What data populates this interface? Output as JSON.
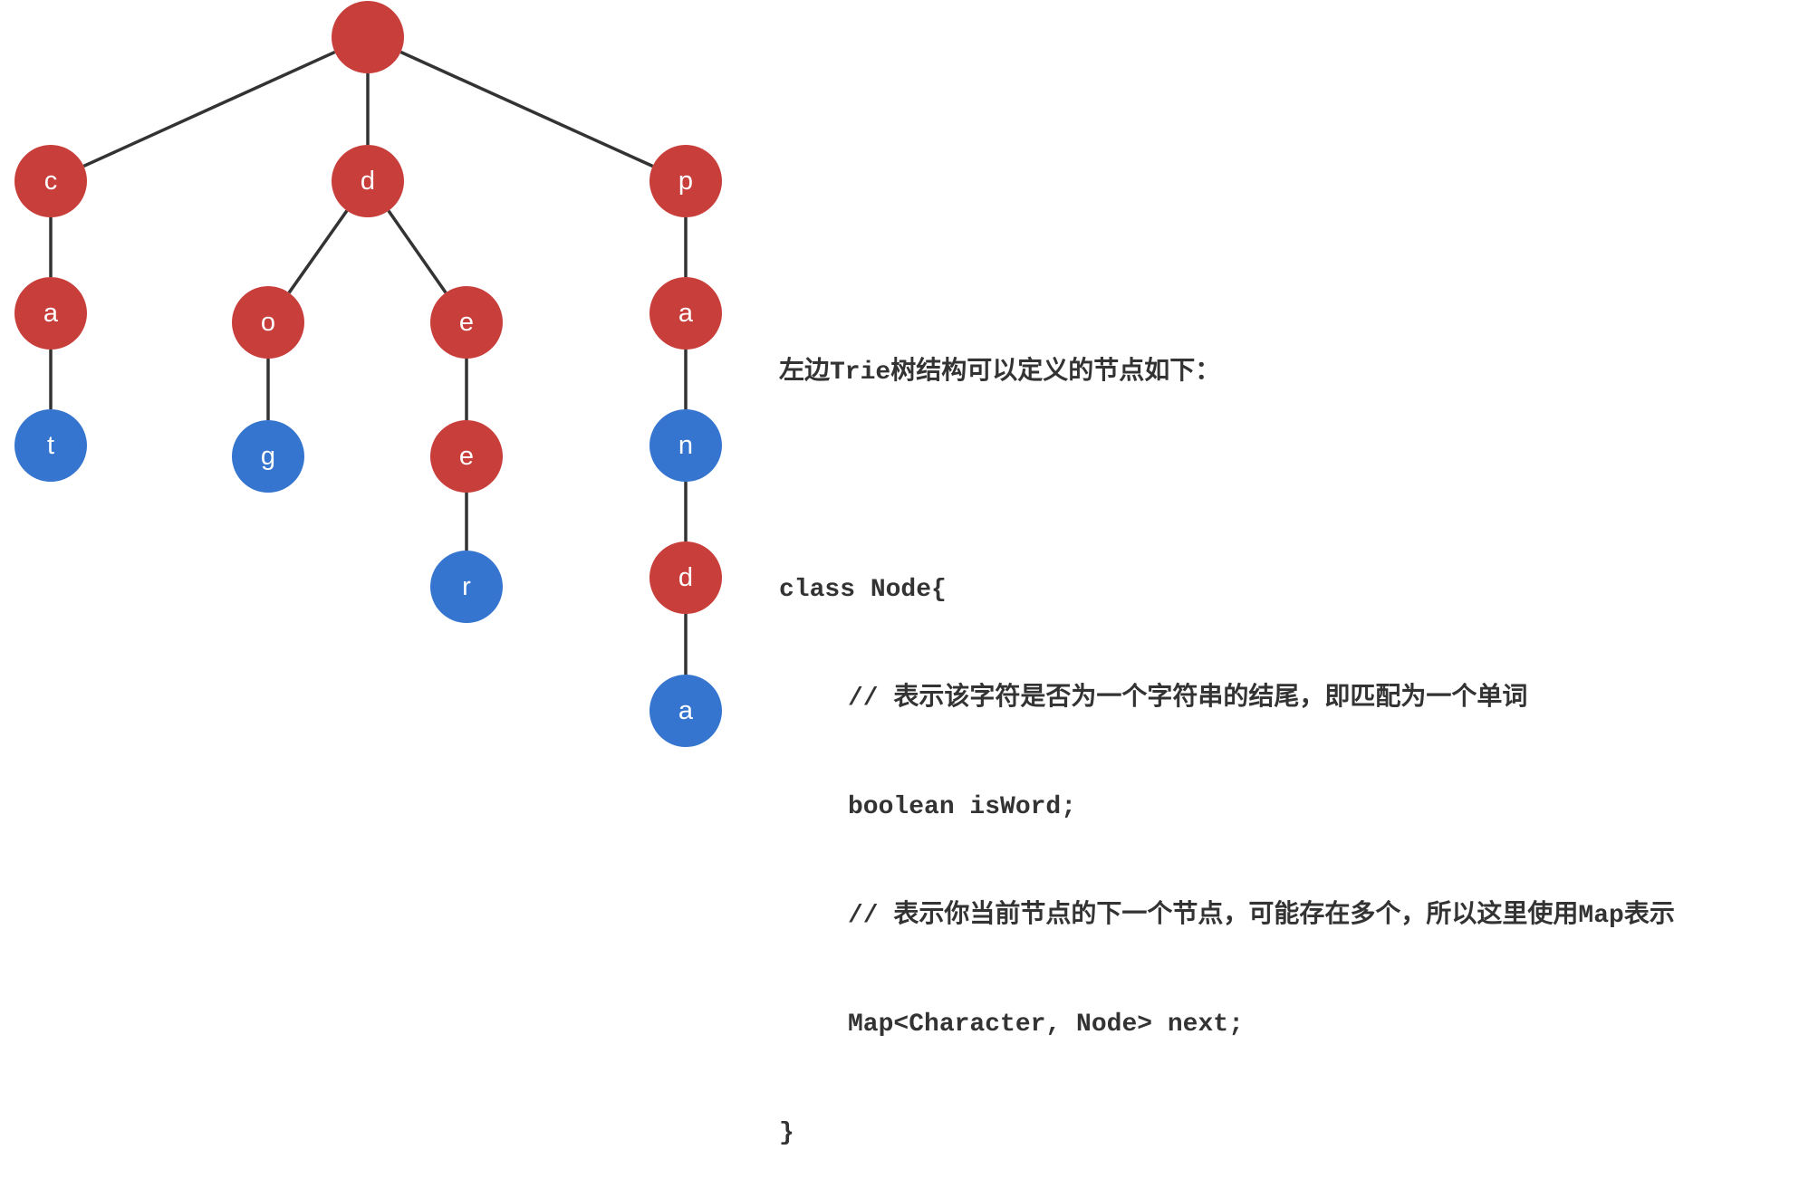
{
  "colors": {
    "inner_node": "#c83e3a",
    "word_end_node": "#3575cf",
    "edge": "#333333",
    "text": "#333333"
  },
  "tree": {
    "nodes": [
      {
        "id": "root",
        "label": "",
        "is_word": false
      },
      {
        "id": "c",
        "label": "c",
        "is_word": false
      },
      {
        "id": "d",
        "label": "d",
        "is_word": false
      },
      {
        "id": "p",
        "label": "p",
        "is_word": false
      },
      {
        "id": "ca",
        "label": "a",
        "is_word": false
      },
      {
        "id": "cat",
        "label": "t",
        "is_word": true
      },
      {
        "id": "do",
        "label": "o",
        "is_word": false
      },
      {
        "id": "dog",
        "label": "g",
        "is_word": true
      },
      {
        "id": "de",
        "label": "e",
        "is_word": false
      },
      {
        "id": "dee",
        "label": "e",
        "is_word": false
      },
      {
        "id": "deer",
        "label": "r",
        "is_word": true
      },
      {
        "id": "pa",
        "label": "a",
        "is_word": false
      },
      {
        "id": "pan",
        "label": "n",
        "is_word": true
      },
      {
        "id": "pand",
        "label": "d",
        "is_word": false
      },
      {
        "id": "panda",
        "label": "a",
        "is_word": true
      }
    ],
    "edges": [
      [
        "root",
        "c"
      ],
      [
        "root",
        "d"
      ],
      [
        "root",
        "p"
      ],
      [
        "c",
        "ca"
      ],
      [
        "ca",
        "cat"
      ],
      [
        "d",
        "do"
      ],
      [
        "do",
        "dog"
      ],
      [
        "d",
        "de"
      ],
      [
        "de",
        "dee"
      ],
      [
        "dee",
        "deer"
      ],
      [
        "p",
        "pa"
      ],
      [
        "pa",
        "pan"
      ],
      [
        "pan",
        "pand"
      ],
      [
        "pand",
        "panda"
      ]
    ]
  },
  "description": {
    "heading": "左边Trie树结构可以定义的节点如下：",
    "code_open": "class Node{",
    "comment_is_word": "// 表示该字符是否为一个字符串的结尾，即匹配为一个单词",
    "field_is_word": "boolean isWord;",
    "comment_next": "// 表示你当前节点的下一个节点，可能存在多个，所以这里使用Map表示",
    "field_next": "Map<Character, Node> next;",
    "code_close": "}"
  }
}
